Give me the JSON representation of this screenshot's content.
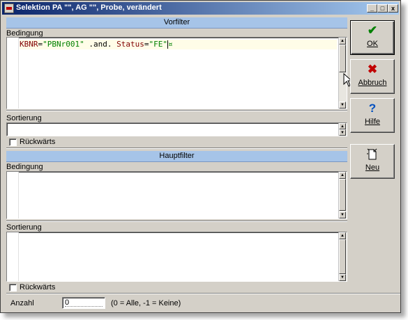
{
  "window": {
    "title": "Selektion PA \"\", AG \"\", Probe, verändert",
    "buttons": {
      "minimize": "_",
      "maximize": "□",
      "close": "x"
    }
  },
  "vorfilter": {
    "header": "Vorfilter",
    "condition_label": "Bedingung",
    "condition_tokens": {
      "field1": "KBNR",
      "eq1": "=",
      "value1": "\"PBNr001\"",
      "andop": " .and. ",
      "field2": "Status",
      "eq2": "=",
      "value2": "\"FE\"",
      "end_marker": "¤"
    },
    "sort_label": "Sortierung",
    "reverse_label": "Rückwärts",
    "reverse_checked": false
  },
  "hauptfilter": {
    "header": "Hauptfilter",
    "condition_label": "Bedingung",
    "sort_label": "Sortierung",
    "reverse_label": "Rückwärts",
    "reverse_checked": false
  },
  "count": {
    "label": "Anzahl",
    "value": "0",
    "hint": "(0 = Alle, -1 = Keine)"
  },
  "actions": [
    {
      "label": "OK",
      "icon": "checkmark-icon",
      "color": "#008000"
    },
    {
      "label": "Abbruch",
      "icon": "cross-icon",
      "color": "#c00000"
    },
    {
      "label": "Hilfe",
      "icon": "question-icon",
      "color": "#0050c0"
    },
    {
      "label": "Neu",
      "icon": "new-document-icon",
      "color": "#000000"
    }
  ]
}
